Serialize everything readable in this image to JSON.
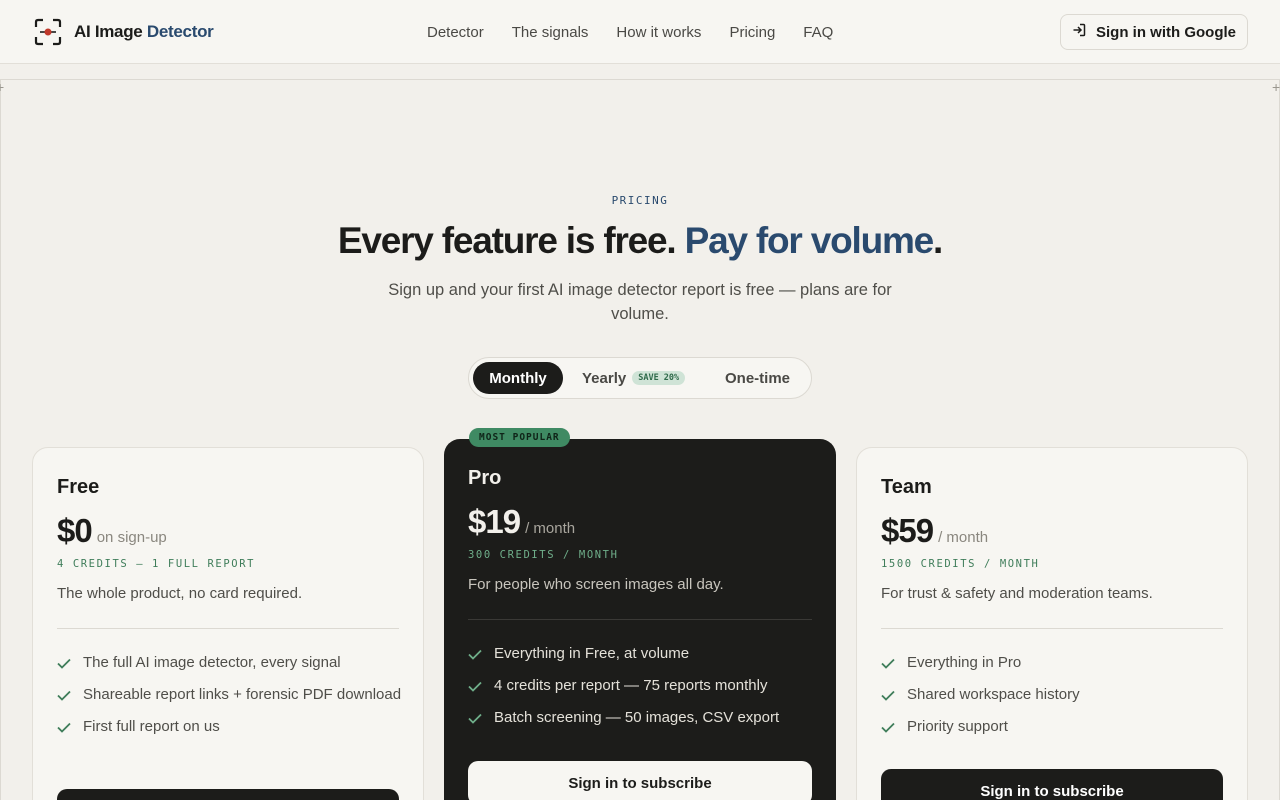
{
  "header": {
    "logo_main": "AI Image",
    "logo_accent": "Detector",
    "nav": [
      "Detector",
      "The signals",
      "How it works",
      "Pricing",
      "FAQ"
    ],
    "signin_label": "Sign in with Google"
  },
  "hero": {
    "eyebrow": "PRICING",
    "headline_main": "Every feature is free.",
    "headline_accent": "Pay for volume",
    "headline_end": ".",
    "subtitle": "Sign up and your first AI image detector report is free — plans are for volume."
  },
  "billing_toggle": {
    "options": [
      "Monthly",
      "Yearly",
      "One-time"
    ],
    "selected": "Monthly",
    "yearly_badge": "SAVE 20%"
  },
  "plans": [
    {
      "name": "Free",
      "price": "$0",
      "period": "on sign-up",
      "credits": "4 CREDITS — 1 FULL REPORT",
      "description": "The whole product, no card required.",
      "features": [
        "The full AI image detector, every signal",
        "Shareable report links + forensic PDF download",
        "First full report on us"
      ],
      "cta": ""
    },
    {
      "name": "Pro",
      "badge": "MOST POPULAR",
      "price": "$19",
      "period": "/ month",
      "credits": "300 CREDITS / MONTH",
      "description": "For people who screen images all day.",
      "features": [
        "Everything in Free, at volume",
        "4 credits per report — 75 reports monthly",
        "Batch screening — 50 images, CSV export"
      ],
      "cta": "Sign in to subscribe"
    },
    {
      "name": "Team",
      "price": "$59",
      "period": "/ month",
      "credits": "1500 CREDITS / MONTH",
      "description": "For trust & safety and moderation teams.",
      "features": [
        "Everything in Pro",
        "Shared workspace history",
        "Priority support"
      ],
      "cta": "Sign in to subscribe"
    }
  ],
  "icons": {
    "logo": "scan-frame-icon",
    "signin": "sign-in-arrow-icon",
    "feature": "check-icon"
  },
  "colors": {
    "accent": "#2a4a6e",
    "check": "#3f7d5a",
    "dark_card": "#1c1c1a",
    "background": "#f2f0eb"
  }
}
